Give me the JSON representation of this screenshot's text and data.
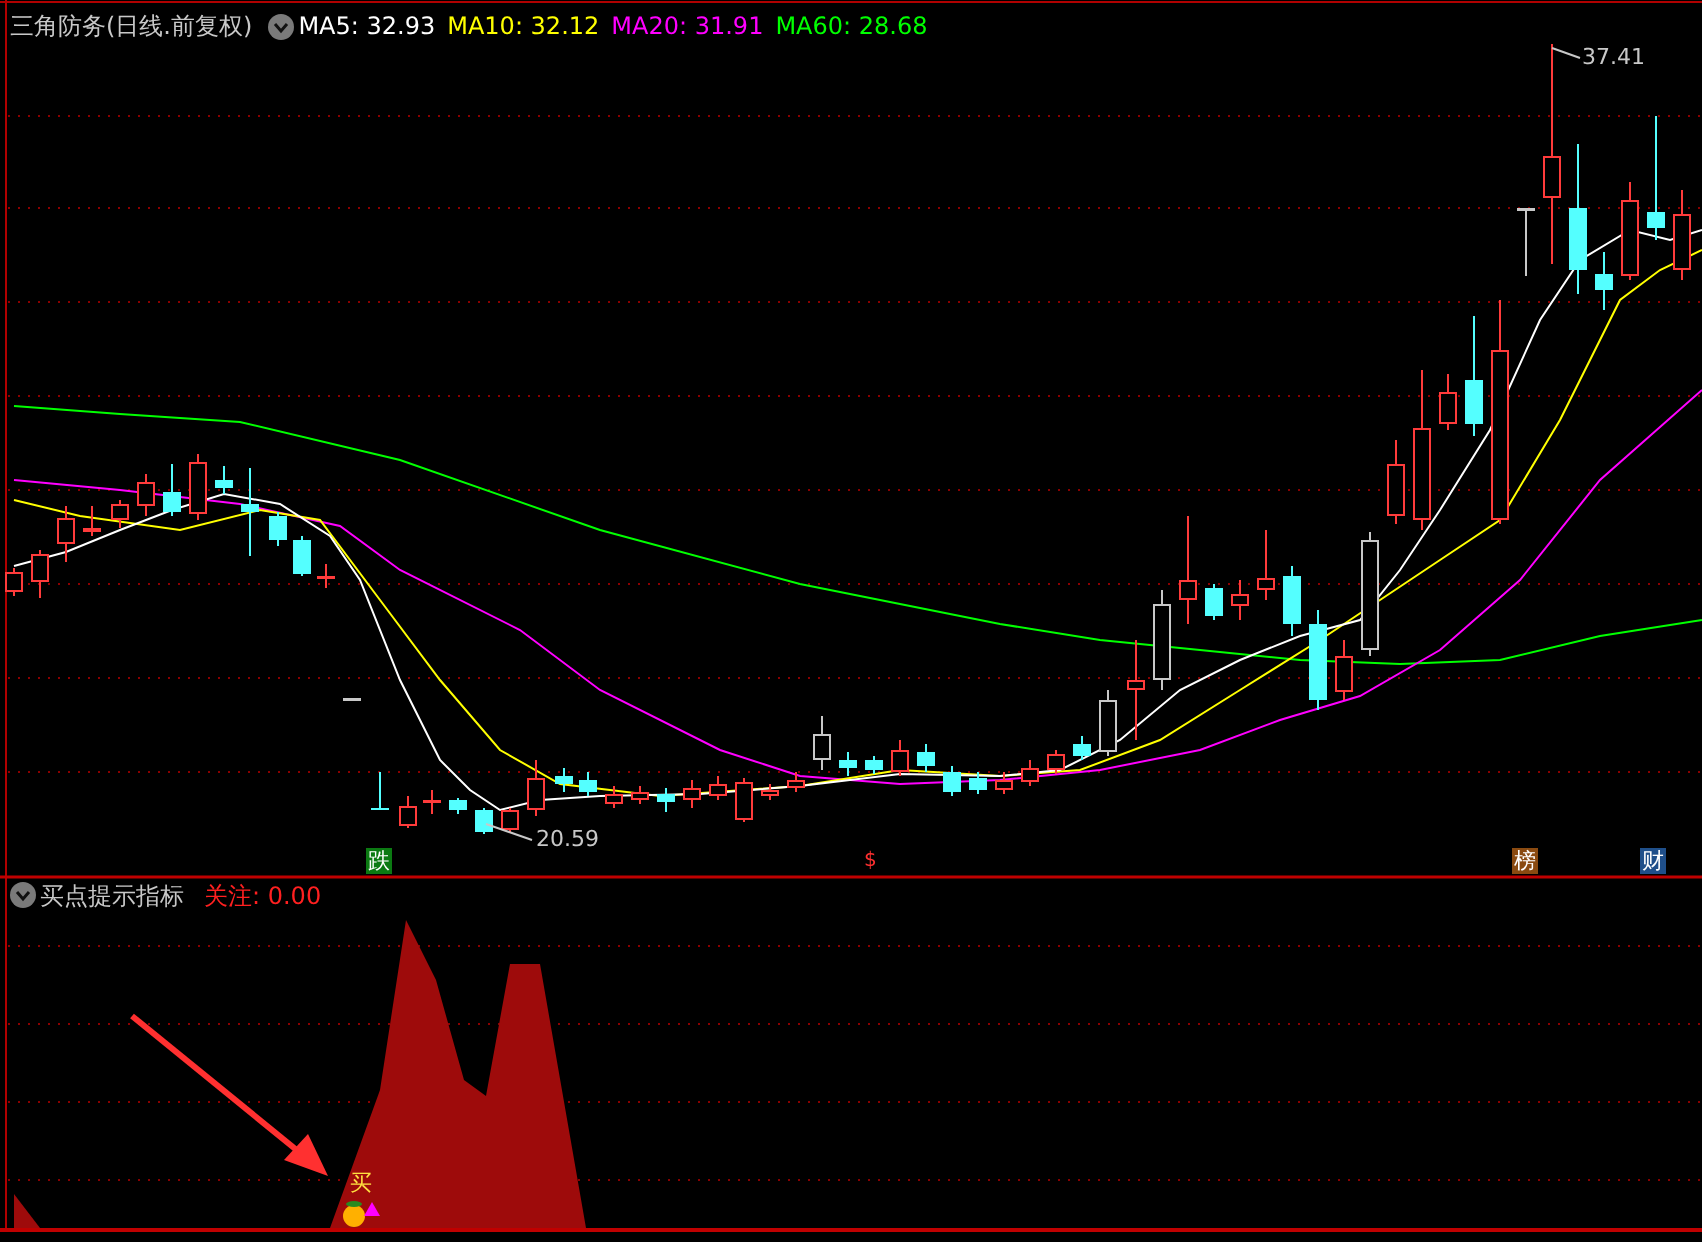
{
  "header": {
    "title": "三角防务(日线.前复权)",
    "ma_values": [
      {
        "text": "MA5: 32.93",
        "color": "#ffffff"
      },
      {
        "text": "MA10: 32.12",
        "color": "#ffff00"
      },
      {
        "text": "MA20: 31.91",
        "color": "#ff00ff"
      },
      {
        "text": "MA60: 28.68",
        "color": "#00ff00"
      }
    ]
  },
  "price_labels": [
    {
      "kind": "high",
      "text": "37.41"
    },
    {
      "kind": "low",
      "text": "20.59"
    }
  ],
  "event_markers": [
    {
      "kind": "badge",
      "text": "跌",
      "color": "#0b7a12"
    },
    {
      "kind": "symbol",
      "text": "$",
      "color": "#ff3030"
    },
    {
      "kind": "badge",
      "text": "榜",
      "color": "#8a4a10"
    },
    {
      "kind": "badge",
      "text": "财",
      "color": "#1f4f8a"
    }
  ],
  "indicator": {
    "title": "买点提示指标",
    "reading": "关注: 0.00",
    "signal_text": "买"
  }
}
